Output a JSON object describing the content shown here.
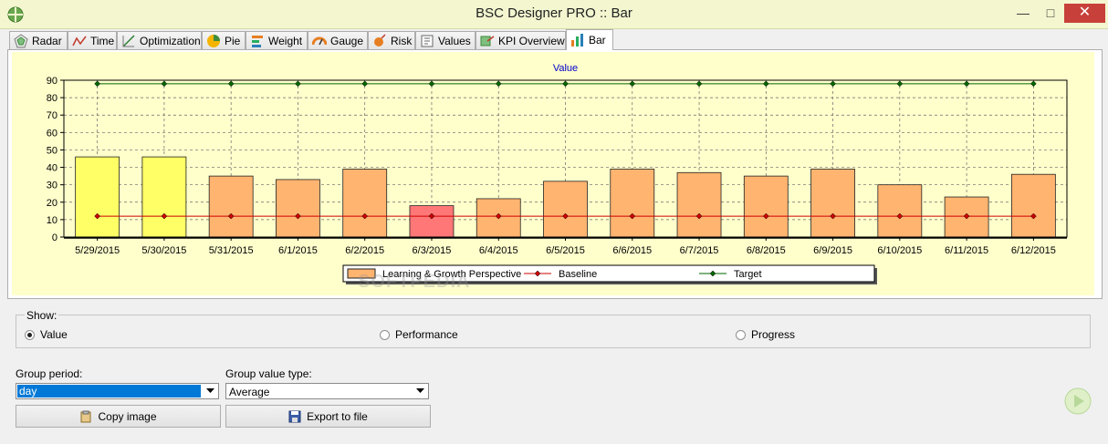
{
  "window": {
    "title": "BSC Designer PRO :: Bar",
    "minimize": "—",
    "maximize": "□",
    "close": "✕"
  },
  "tabs": [
    {
      "label": "Radar",
      "icon": "radar-icon"
    },
    {
      "label": "Time",
      "icon": "time-chart-icon"
    },
    {
      "label": "Optimization",
      "icon": "optimization-icon"
    },
    {
      "label": "Pie",
      "icon": "pie-chart-icon"
    },
    {
      "label": "Weight",
      "icon": "weight-icon"
    },
    {
      "label": "Gauge",
      "icon": "gauge-icon"
    },
    {
      "label": "Risk",
      "icon": "risk-icon"
    },
    {
      "label": "Values",
      "icon": "values-icon"
    },
    {
      "label": "KPI Overview",
      "icon": "kpi-overview-icon"
    },
    {
      "label": "Bar",
      "icon": "bar-chart-icon",
      "active": true
    }
  ],
  "watermark": "SOFTPEDIA",
  "show": {
    "label": "Show:",
    "options": [
      {
        "label": "Value",
        "selected": true
      },
      {
        "label": "Performance",
        "selected": false
      },
      {
        "label": "Progress",
        "selected": false
      }
    ]
  },
  "group_period": {
    "label": "Group period:",
    "value": "day"
  },
  "group_value_type": {
    "label": "Group value type:",
    "value": "Average"
  },
  "buttons": {
    "copy_image": "Copy image",
    "export": "Export to file"
  },
  "chart_data": {
    "type": "bar",
    "title": "Value",
    "categories": [
      "5/29/2015",
      "5/30/2015",
      "5/31/2015",
      "6/1/2015",
      "6/2/2015",
      "6/3/2015",
      "6/4/2015",
      "6/5/2015",
      "6/6/2015",
      "6/7/2015",
      "6/8/2015",
      "6/9/2015",
      "6/10/2015",
      "6/11/2015",
      "6/12/2015"
    ],
    "series": [
      {
        "name": "Learning & Growth Perspective",
        "kind": "bar",
        "values": [
          46,
          46,
          35,
          33,
          39,
          18,
          22,
          32,
          39,
          37,
          35,
          39,
          30,
          23,
          36
        ],
        "colors": [
          "#ffff66",
          "#ffff66",
          "#ffb470",
          "#ffb470",
          "#ffb470",
          "#ff7777",
          "#ffb470",
          "#ffb470",
          "#ffb470",
          "#ffb470",
          "#ffb470",
          "#ffb470",
          "#ffb470",
          "#ffb470",
          "#ffb470"
        ]
      },
      {
        "name": "Baseline",
        "kind": "line",
        "color": "#cc0000",
        "values": [
          12,
          12,
          12,
          12,
          12,
          12,
          12,
          12,
          12,
          12,
          12,
          12,
          12,
          12,
          12
        ]
      },
      {
        "name": "Target",
        "kind": "line",
        "color": "#006600",
        "values": [
          88,
          88,
          88,
          88,
          88,
          88,
          88,
          88,
          88,
          88,
          88,
          88,
          88,
          88,
          88
        ]
      }
    ],
    "yticks": [
      0,
      10,
      20,
      30,
      40,
      50,
      60,
      70,
      80,
      90
    ],
    "ylim": [
      0,
      90
    ],
    "grid": true,
    "legend_position": "bottom"
  }
}
